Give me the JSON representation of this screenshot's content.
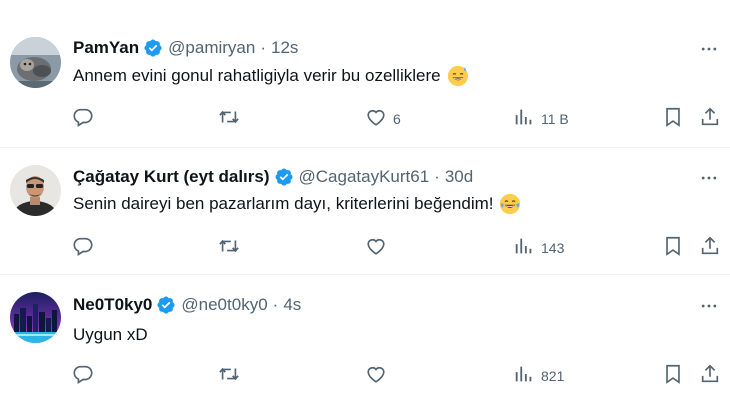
{
  "tweets": [
    {
      "display_name": "PamYan",
      "handle": "@pamiryan",
      "separator": "·",
      "time": "12s",
      "text": "Annem evini gonul rahatligiyla verir bu ozelliklere",
      "emoji": "sweat-smile-emoji",
      "likes": "6",
      "views": "11 B",
      "retweets": "",
      "replies": ""
    },
    {
      "display_name": "Çağatay Kurt (eyt dalırs)",
      "handle": "@CagatayKurt61",
      "separator": "·",
      "time": "30d",
      "text": "Senin daireyi ben pazarlarım dayı, kriterlerini beğendim!",
      "emoji": "tears-of-joy-emoji",
      "likes": "",
      "views": "143",
      "retweets": "",
      "replies": ""
    },
    {
      "display_name": "Ne0T0ky0",
      "handle": "@ne0t0ky0",
      "separator": "·",
      "time": "4s",
      "text": "Uygun xD",
      "emoji": "",
      "likes": "",
      "views": "821",
      "retweets": "",
      "replies": ""
    }
  ],
  "icons": {
    "verified": "verified-badge-icon",
    "more": "more-icon",
    "reply": "reply-icon",
    "retweet": "retweet-icon",
    "like": "like-icon",
    "views": "views-icon",
    "bookmark": "bookmark-icon",
    "share": "share-icon"
  },
  "colors": {
    "verified_blue": "#1d9bf0",
    "text_primary": "#0f1419",
    "text_secondary": "#536471",
    "divider": "#eff3f4"
  }
}
